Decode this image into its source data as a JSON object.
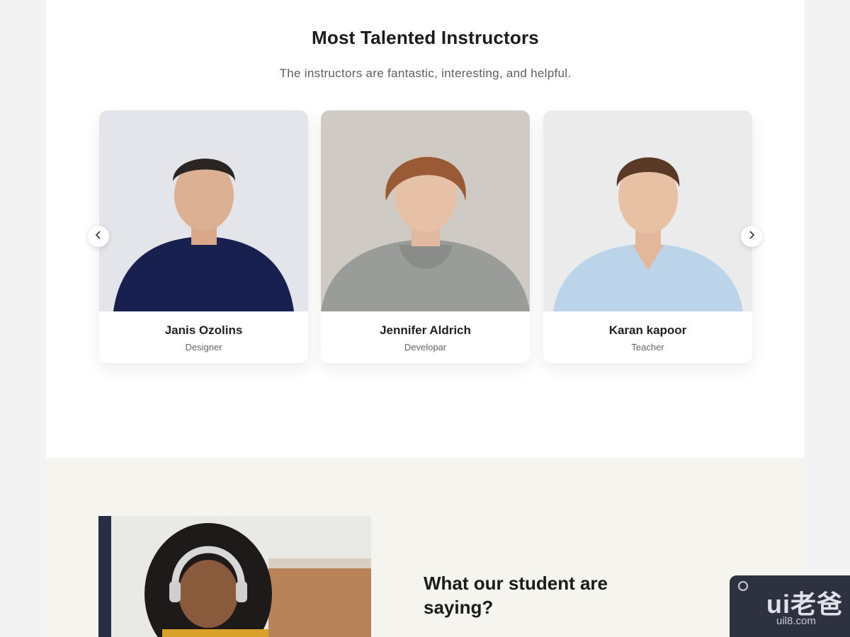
{
  "instructors_section": {
    "title": "Most Talented Instructors",
    "subtitle": "The instructors are fantastic, interesting, and helpful.",
    "cards": [
      {
        "name": "Janis Ozolins",
        "role": "Designer"
      },
      {
        "name": "Jennifer Aldrich",
        "role": "Developar"
      },
      {
        "name": "Karan kapoor",
        "role": "Teacher"
      }
    ],
    "prev_icon": "chevron-left-icon",
    "next_icon": "chevron-right-icon"
  },
  "testimonials_section": {
    "title_line1": "What our student are",
    "title_line2": "saying?"
  },
  "watermark": {
    "logo": "ui老爸",
    "url": "uil8.com"
  },
  "colors": {
    "page_bg": "#f3f3f3",
    "section_bg": "#ffffff",
    "testimonial_bg": "#f5f4ef",
    "heading": "#1b1b1b",
    "subtext": "#5e5e5e"
  }
}
